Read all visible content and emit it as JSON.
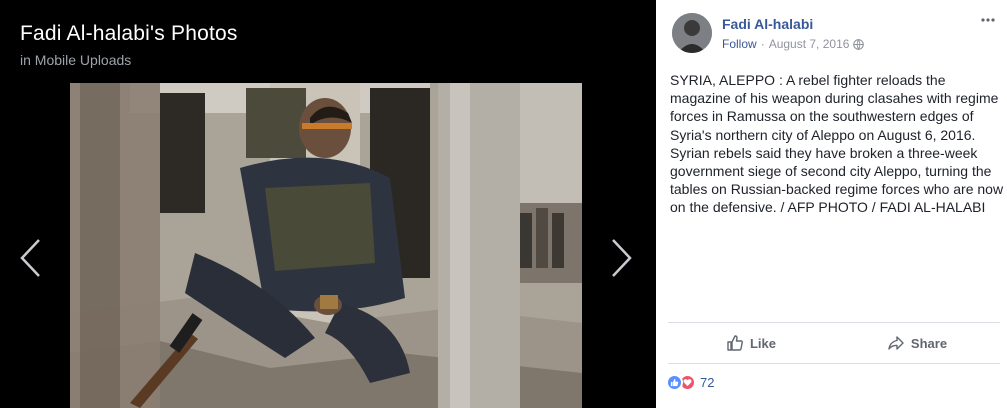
{
  "viewer": {
    "title": "Fadi Al-halabi's Photos",
    "subtitle": "in Mobile Uploads",
    "prev_icon": "chevron-left-icon",
    "next_icon": "chevron-right-icon"
  },
  "post": {
    "author": "Fadi Al-halabi",
    "follow_label": "Follow",
    "separator": "·",
    "date": "August 7, 2016",
    "privacy_icon": "globe-icon",
    "more_icon": "ellipsis-icon",
    "caption": "SYRIA, ALEPPO : A rebel fighter reloads the magazine of his weapon during clasahes with regime forces in Ramussa on the southwestern edges of Syria's northern city of Aleppo on August 6, 2016.\nSyrian rebels said they have broken a three-week government siege of second city Aleppo, turning the tables on Russian-backed regime forces who are now on the defensive. / AFP PHOTO / FADI AL-HALABI"
  },
  "actions": {
    "like_label": "Like",
    "share_label": "Share"
  },
  "reactions": {
    "count": "72",
    "types": [
      "like",
      "love"
    ]
  },
  "colors": {
    "link": "#385898",
    "like": "#5890ff",
    "love": "#f25268",
    "text": "#1d2129",
    "muted": "#90949c"
  }
}
